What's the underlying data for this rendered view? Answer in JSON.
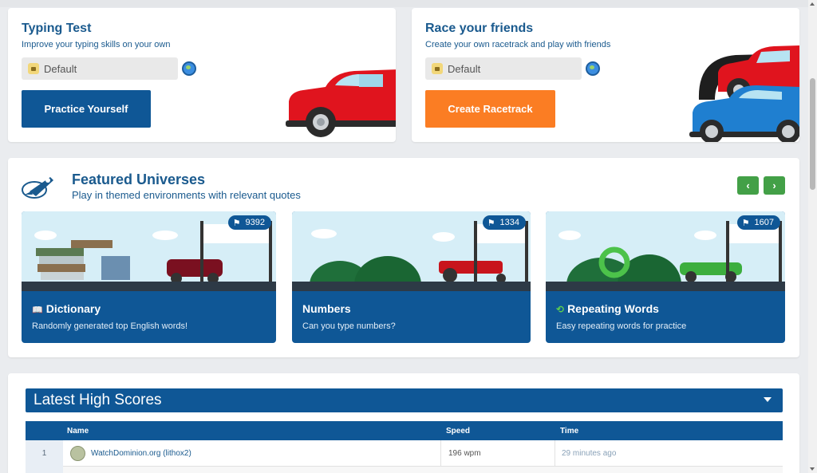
{
  "typing_test": {
    "title": "Typing Test",
    "subtitle": "Improve your typing skills on your own",
    "select_value": "Default",
    "button": "Practice Yourself"
  },
  "race_friends": {
    "title": "Race your friends",
    "subtitle": "Create your own racetrack and play with friends",
    "select_value": "Default",
    "button": "Create Racetrack"
  },
  "featured": {
    "title": "Featured Universes",
    "subtitle": "Play in themed environments with relevant quotes",
    "prev_label": "‹",
    "next_label": "›",
    "universes": [
      {
        "name": "Dictionary",
        "description": "Randomly generated top English words!",
        "count": "9392",
        "icon": "book-icon"
      },
      {
        "name": "Numbers",
        "description": "Can you type numbers?",
        "count": "1334",
        "icon": ""
      },
      {
        "name": "Repeating Words",
        "description": "Easy repeating words for practice",
        "count": "1607",
        "icon": "repeat-icon"
      }
    ]
  },
  "high_scores": {
    "title": "Latest High Scores",
    "columns": {
      "name": "Name",
      "speed": "Speed",
      "time": "Time"
    },
    "rows": [
      {
        "rank": "1",
        "name": "WatchDominion.org (lithox2)",
        "speed": "196 wpm",
        "time": "29 minutes ago"
      }
    ]
  },
  "colors": {
    "brand_blue": "#0f5796",
    "orange": "#fb7d23",
    "green": "#43a047",
    "title_blue": "#1a5a8e"
  }
}
